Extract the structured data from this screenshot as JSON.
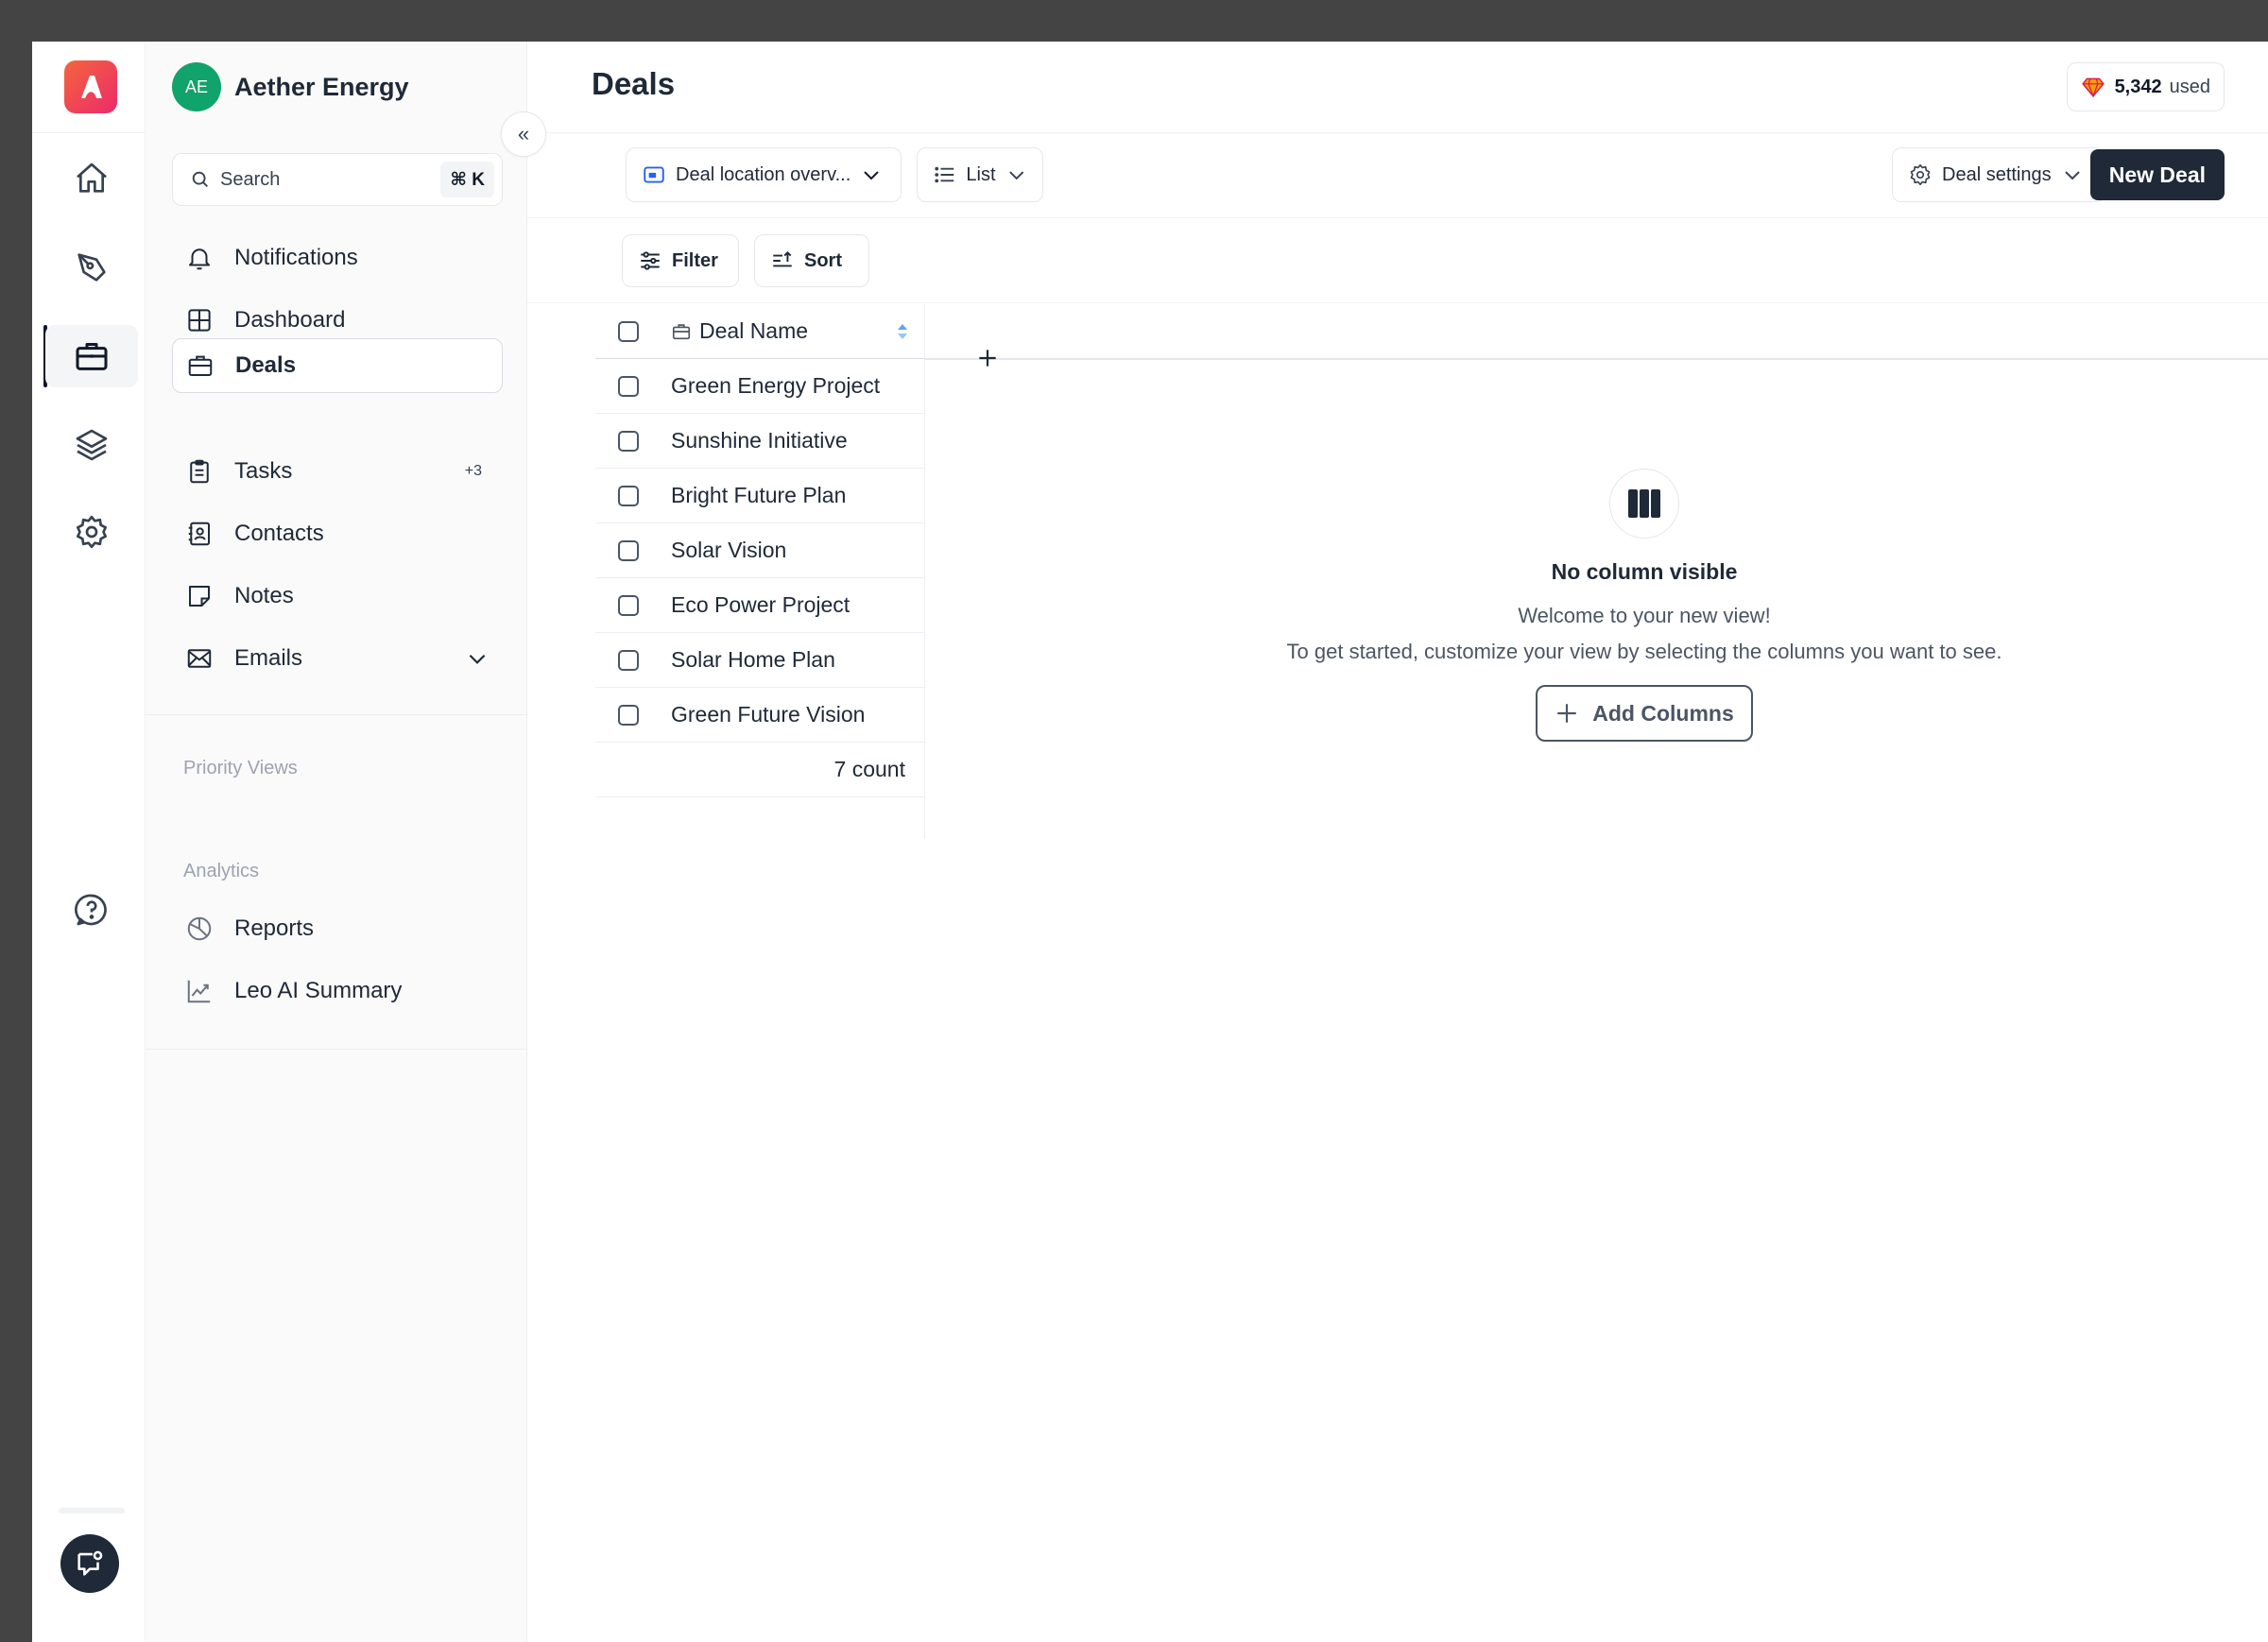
{
  "workspace": {
    "initials": "AE",
    "name": "Aether Energy"
  },
  "sidebar": {
    "search_placeholder": "Search",
    "search_shortcut": "⌘ K",
    "items": [
      {
        "label": "Notifications",
        "icon": "bell-icon"
      },
      {
        "label": "Dashboard",
        "icon": "grid-icon"
      },
      {
        "label": "Deals",
        "icon": "briefcase-icon",
        "active": true
      },
      {
        "label": "Tasks",
        "icon": "clipboard-icon",
        "badge": "+3"
      },
      {
        "label": "Contacts",
        "icon": "contact-book-icon"
      },
      {
        "label": "Notes",
        "icon": "note-icon"
      },
      {
        "label": "Emails",
        "icon": "mail-icon"
      }
    ],
    "priority_views_title": "Priority Views",
    "analytics_title": "Analytics",
    "analytics_items": [
      {
        "label": "Reports",
        "icon": "pie-chart-icon"
      },
      {
        "label": "Leo AI Summary",
        "icon": "trend-chart-icon"
      }
    ]
  },
  "header": {
    "title": "Deals",
    "credits_value": "5,342",
    "credits_suffix": "used"
  },
  "toolbar": {
    "view_select": "Deal location overv...",
    "layout_select": "List",
    "settings_label": "Deal settings",
    "new_button": "New Deal",
    "filter_label": "Filter",
    "sort_label": "Sort"
  },
  "table": {
    "column_header": "Deal Name",
    "rows": [
      "Green Energy Project",
      "Sunshine Initiative",
      "Bright Future Plan",
      "Solar Vision",
      "Eco Power Project",
      "Solar Home Plan",
      "Green Future Vision"
    ],
    "count_label": "7 count"
  },
  "empty_state": {
    "title": "No column visible",
    "line1": "Welcome to your new view!",
    "line2": "To get started, customize your view by selecting the columns you want to see.",
    "button": "Add Columns"
  },
  "colors": {
    "primary_button": "#1f2937",
    "workspace_avatar": "#10a36c",
    "logo_gradient_start": "#f4653c",
    "logo_gradient_end": "#ec2a6b"
  }
}
